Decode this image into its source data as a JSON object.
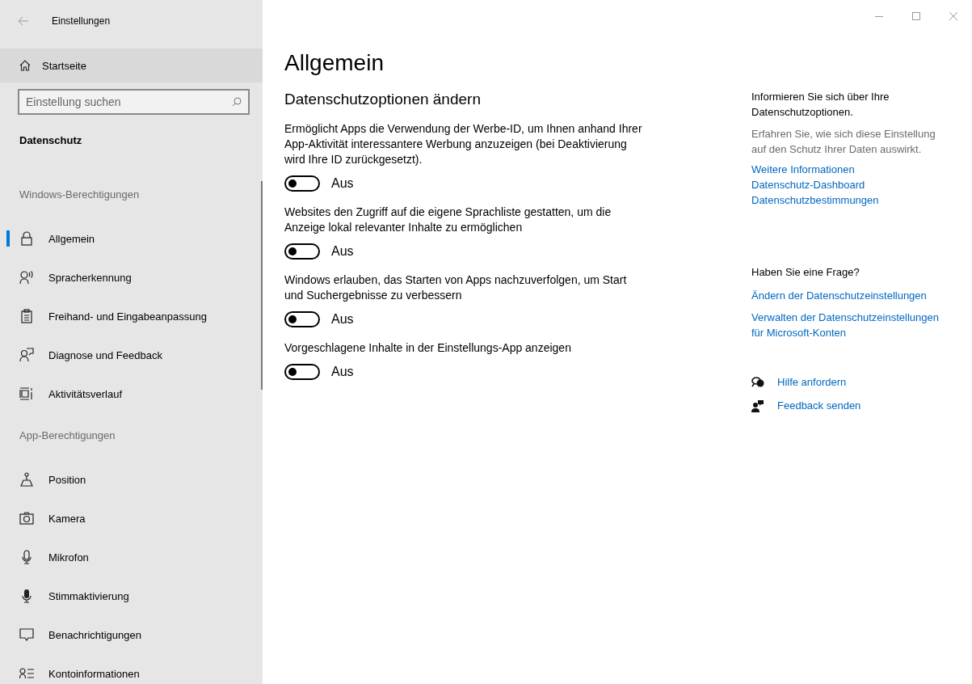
{
  "window": {
    "title": "Einstellungen"
  },
  "sidebar": {
    "home": "Startseite",
    "search": {
      "placeholder": "Einstellung suchen"
    },
    "category": "Datenschutz",
    "sections": [
      {
        "heading": "Windows-Berechtigungen",
        "items": [
          {
            "label": "Allgemein",
            "selected": true
          },
          {
            "label": "Spracherkennung",
            "selected": false
          },
          {
            "label": "Freihand- und Eingabeanpassung",
            "selected": false
          },
          {
            "label": "Diagnose und Feedback",
            "selected": false
          },
          {
            "label": "Aktivitätsverlauf",
            "selected": false
          }
        ]
      },
      {
        "heading": "App-Berechtigungen",
        "items": [
          {
            "label": "Position",
            "selected": false
          },
          {
            "label": "Kamera",
            "selected": false
          },
          {
            "label": "Mikrofon",
            "selected": false
          },
          {
            "label": "Stimmaktivierung",
            "selected": false
          },
          {
            "label": "Benachrichtigungen",
            "selected": false
          },
          {
            "label": "Kontoinformationen",
            "selected": false
          }
        ]
      }
    ]
  },
  "main": {
    "title": "Allgemein",
    "subtitle": "Datenschutzoptionen ändern",
    "options": [
      {
        "description": "Ermöglicht Apps die Verwendung der Werbe-ID, um Ihnen anhand Ihrer App-Aktivität interessantere Werbung anzuzeigen (bei Deaktivierung wird Ihre ID zurückgesetzt).",
        "on": false,
        "state_label": "Aus"
      },
      {
        "description": "Websites den Zugriff auf die eigene Sprachliste gestatten, um die Anzeige lokal relevanter Inhalte zu ermöglichen",
        "on": false,
        "state_label": "Aus"
      },
      {
        "description": "Windows erlauben, das Starten von Apps nachzuverfolgen, um Start und Suchergebnisse zu verbessern",
        "on": false,
        "state_label": "Aus"
      },
      {
        "description": "Vorgeschlagene Inhalte in der Einstellungs-App anzeigen",
        "on": false,
        "state_label": "Aus"
      }
    ]
  },
  "help_panel": {
    "info_title": "Informieren Sie sich über Ihre Datenschutzoptionen.",
    "info_text": "Erfahren Sie, wie sich diese Einstellung auf den Schutz Ihrer Daten auswirkt.",
    "info_links": [
      "Weitere Informationen",
      "Datenschutz-Dashboard",
      "Datenschutzbestimmungen"
    ],
    "question_title": "Haben Sie eine Frage?",
    "question_links": [
      "Ändern der Datenschutzeinstellungen",
      "Verwalten der Datenschutzeinstellungen für Microsoft-Konten"
    ],
    "actions": [
      "Hilfe anfordern",
      "Feedback senden"
    ]
  }
}
